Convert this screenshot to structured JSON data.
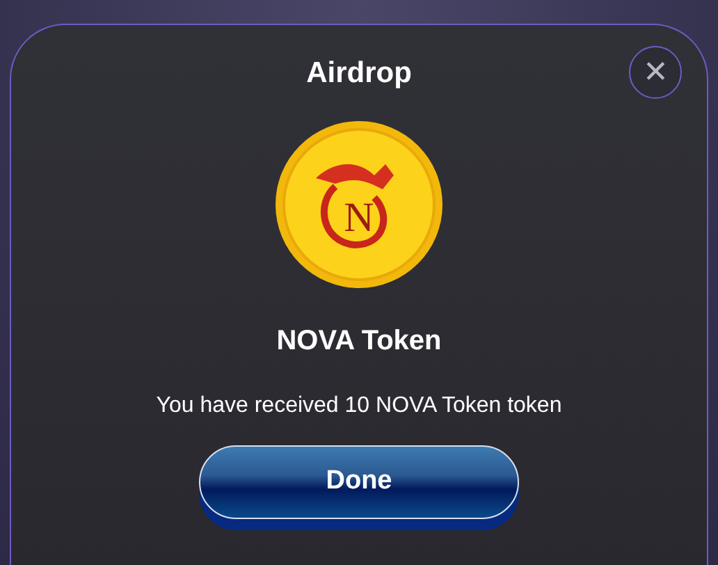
{
  "dialog": {
    "title": "Airdrop",
    "close_label": "✕",
    "coin_letter": "N",
    "token_name": "NOVA Token",
    "message": "You have received 10 NOVA Token token",
    "button": "Done"
  }
}
